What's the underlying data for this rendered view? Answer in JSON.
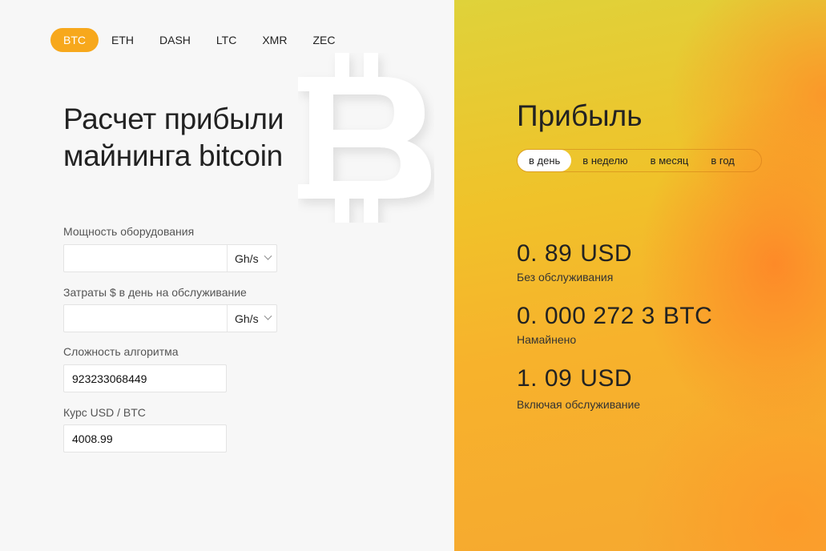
{
  "coins": {
    "tabs": [
      "BTC",
      "ETH",
      "DASH",
      "LTC",
      "XMR",
      "ZEC"
    ],
    "active": "BTC"
  },
  "form": {
    "title_line1": "Расчет прибыли",
    "title_line2": "майнинга bitcoin",
    "hashrate_label": "Мощность оборудования",
    "hashrate_value": "",
    "hashrate_unit": "Gh/s",
    "cost_label": "Затраты $ в день на обслуживание",
    "cost_value": "",
    "cost_unit": "Gh/s",
    "difficulty_label": "Сложность алгоритма",
    "difficulty_value": "923233068449",
    "rate_label": "Курс  USD / BTC",
    "rate_value": "4008.99"
  },
  "profit": {
    "title": "Прибыль",
    "periods": [
      "в день",
      "в неделю",
      "в месяц",
      "в год"
    ],
    "active_period": "в день",
    "results": [
      {
        "value": "0. 89",
        "currency": "USD",
        "label": "Без обслуживания"
      },
      {
        "value": "0. 000 272 3",
        "currency": "BTC",
        "label": "Намайнено"
      },
      {
        "value": "1. 09",
        "currency": "USD",
        "label": "Включая обслуживание"
      }
    ]
  },
  "colors": {
    "accent": "#f7a81c",
    "right_panel_start": "#dfd23a",
    "right_panel_end": "#f6a830"
  },
  "icons": {
    "logo": "bitcoin-logo-icon",
    "select_chevron": "chevron-down-icon"
  }
}
